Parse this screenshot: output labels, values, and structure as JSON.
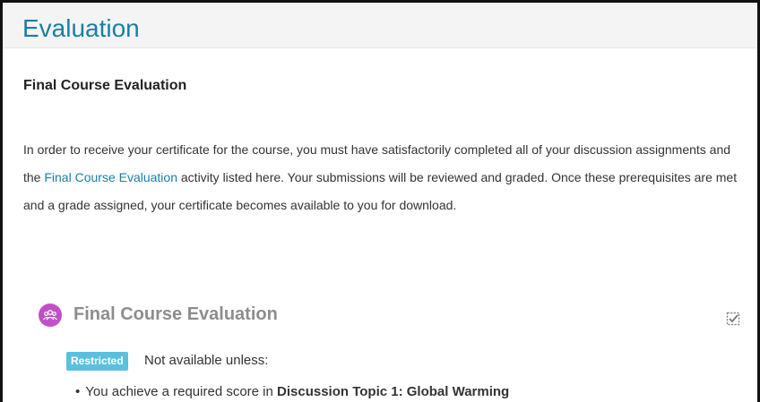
{
  "header": {
    "title": "Evaluation"
  },
  "section": {
    "title": "Final Course Evaluation",
    "paragraph_start": "In order to receive your certificate for the course, you must have satisfactorily completed all of your discussion assignments and the ",
    "paragraph_link": "Final Course Evaluation",
    "paragraph_end": " activity listed here. Your submissions will be reviewed and graded. Once these prerequisites are met and a grade assigned, your certificate becomes available to you for download."
  },
  "activity": {
    "name": "Final Course Evaluation",
    "icon": "group-icon",
    "completion_icon": "completion-checkbox-icon",
    "restriction": {
      "badge": "Restricted",
      "label": "Not available unless:",
      "conditions": [
        {
          "bullet": "•",
          "text": "You achieve a required score in ",
          "target": "Discussion Topic 1: Global Warming"
        }
      ]
    }
  },
  "colors": {
    "accent": "#1a7fa3",
    "icon_bg": "#c150c6",
    "badge_bg": "#5bc0de"
  }
}
